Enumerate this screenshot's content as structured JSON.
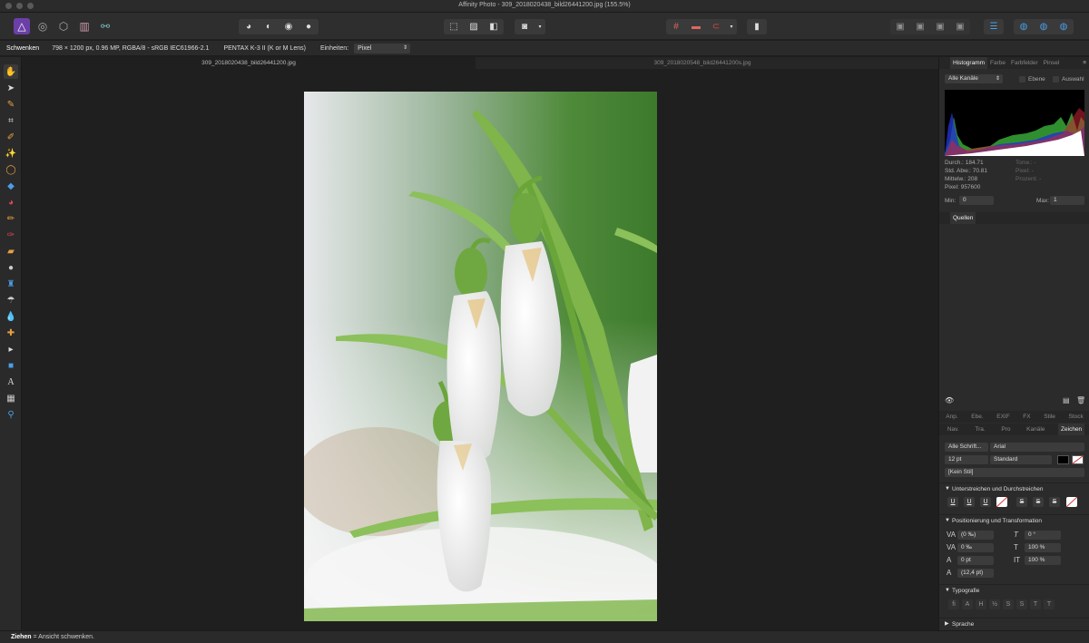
{
  "window": {
    "title": "Affinity Photo - 309_2018020438_bild26441200.jpg (155.5%)"
  },
  "context": {
    "tool_name": "Schwenken",
    "doc_info": "798 × 1200 px, 0.96 MP, RGBA/8 - sRGB IEC61966-2.1",
    "camera": "PENTAX K-3 II (K or M Lens)",
    "units_label": "Einheiten:",
    "units_value": "Pixel"
  },
  "tabs": [
    {
      "label": "309_2018020438_bild26441200.jpg"
    },
    {
      "label": "309_2018020548_bild26441200s.jpg"
    }
  ],
  "panel_top": {
    "tabs": [
      "Histogramm",
      "Farbe",
      "Farbfelder",
      "Pinsel"
    ],
    "channel_select": "Alle Kanäle",
    "check_layer": "Ebene",
    "check_selection": "Auswahl",
    "stats_left": [
      "Durch.: 184.71",
      "Std. Abw.: 70.81",
      "Mittelw.: 208",
      "Pixel: 957600"
    ],
    "stats_right": [
      "Tonw.: -",
      "Pixel: -",
      "Prozent: -"
    ],
    "min_label": "Min:",
    "min_value": "0",
    "max_label": "Max:",
    "max_value": "1"
  },
  "panel_quellen": {
    "title": "Quellen"
  },
  "panel_mid_tabs": [
    "Anp.",
    "Ebe.",
    "EXIF",
    "FX",
    "Stile",
    "Stock"
  ],
  "panel_lower_tabs": [
    "Nav.",
    "Tra.",
    "Pro",
    "Kanäle",
    "Zeichen"
  ],
  "character": {
    "font_collection": "Alle Schrift...",
    "font_name": "Arial",
    "font_size": "12 pt",
    "font_style": "Standard",
    "style_name": "[Kein Stil]",
    "underline_header": "Unterstreichen und Durchstreichen",
    "position_header": "Positionierung und Transformation",
    "tracking": "(0 ‰)",
    "shear": "0 °",
    "kerning": "0 ‰",
    "hscale": "100 %",
    "baseline": "0 pt",
    "vscale": "100 %",
    "leading": "(12,4 pt)",
    "typography_header": "Typografie",
    "language_header": "Sprache"
  },
  "status": {
    "bold": "Ziehen",
    "text": " = Ansicht schwenken."
  }
}
